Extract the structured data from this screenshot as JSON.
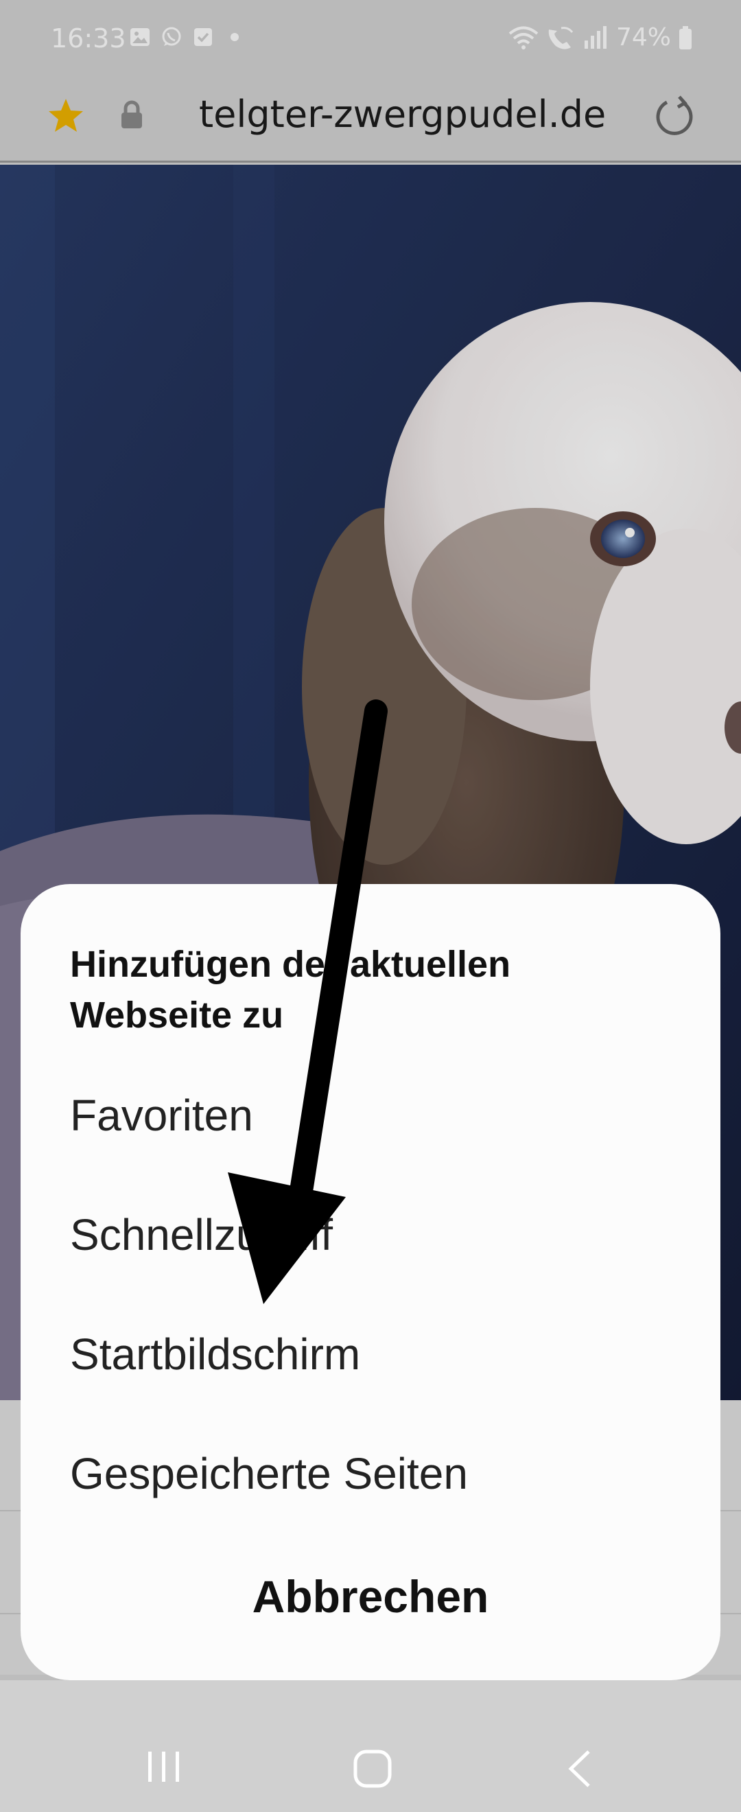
{
  "status_bar": {
    "time": "16:33",
    "battery": "74%",
    "left_icons": [
      "gallery-icon",
      "whatsapp-icon",
      "checkbox-icon",
      "dot-icon"
    ],
    "right_icons": [
      "wifi-icon",
      "wifi-calling-icon",
      "signal-icon",
      "battery-icon"
    ]
  },
  "address_bar": {
    "url": "telgter-zwergpudel.de",
    "star_color": "#f0b400"
  },
  "dialog": {
    "title": "Hinzufügen der aktuellen Webseite zu",
    "items": [
      {
        "label": "Favoriten"
      },
      {
        "label": "Schnellzugriff"
      },
      {
        "label": "Startbildschirm"
      },
      {
        "label": "Gespeicherte Seiten"
      }
    ],
    "cancel_label": "Abbrechen"
  },
  "nav_bar": {
    "icons": [
      "recents-icon",
      "home-icon",
      "back-icon"
    ]
  }
}
